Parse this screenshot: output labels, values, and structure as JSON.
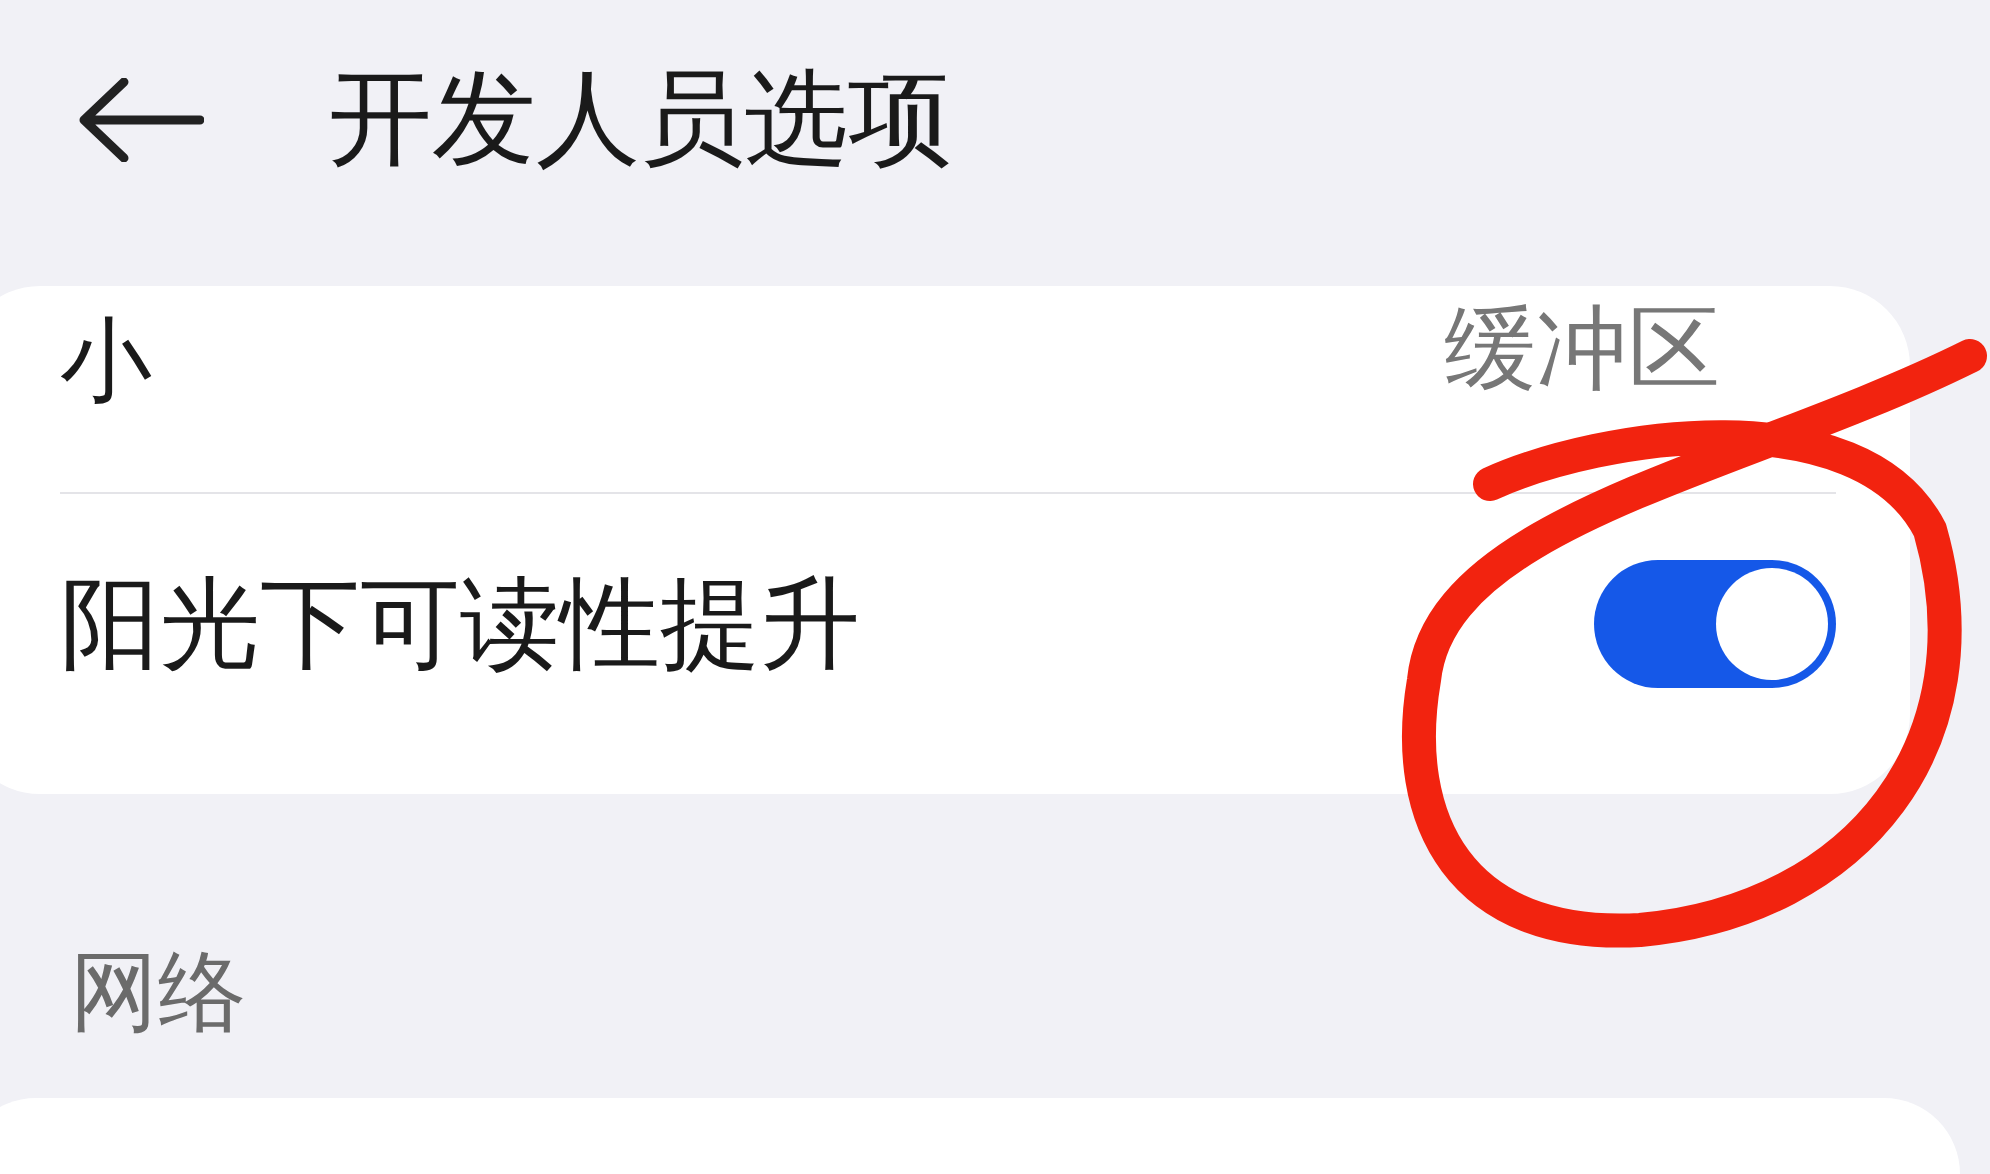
{
  "header": {
    "title": "开发人员选项"
  },
  "card": {
    "rows": [
      {
        "kind": "value",
        "label": "小",
        "value": "缓冲区"
      },
      {
        "kind": "switch",
        "label": "阳光下可读性提升",
        "on": true
      }
    ]
  },
  "section": {
    "title": "网络"
  }
}
